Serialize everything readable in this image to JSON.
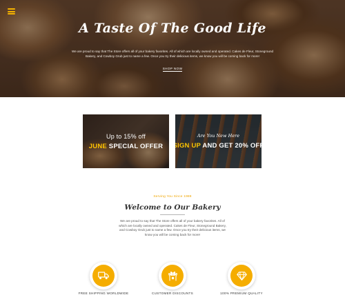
{
  "hero": {
    "title": "A Taste Of The Good Life",
    "text": "We are proud to say that The Store offers all of your bakery favorites. All of which are locally owned and operated. Cakes de Fleur, Stoneground Bakery, and Cowboy Grub just to name a few. Once you try their delicious items, we know you will be coming back for more!",
    "link_label": "SHOP NOW"
  },
  "promos": [
    {
      "top_text": "Up to 15% off",
      "highlight": "JUNE",
      "rest": " SPECIAL OFFER"
    },
    {
      "top_text": "Are You New Here",
      "highlight": "SIGN UP",
      "rest": " AND GET 20% OFF"
    }
  ],
  "welcome": {
    "tagline": "Serving You Since 1988",
    "title": "Welcome to Our Bakery",
    "text": "We are proud to say that The Store offers all of your bakery favorites. All of which are locally owned and operated. Cakes de Fleur, Stoneground Bakery, and Cowboy Grub just to name a few. Once you try their delicious items, we know you will be coming back for more!"
  },
  "features": [
    {
      "icon": "truck-icon",
      "label": "FREE SHIPPING WORLDWIDE"
    },
    {
      "icon": "hands-icon",
      "label": "CUSTOMER DISCOUNTS"
    },
    {
      "icon": "diamond-icon",
      "label": "100% PREMIUM QUALITY"
    }
  ],
  "colors": {
    "accent": "#f5ad00",
    "promo_highlight": "#ffc400"
  }
}
